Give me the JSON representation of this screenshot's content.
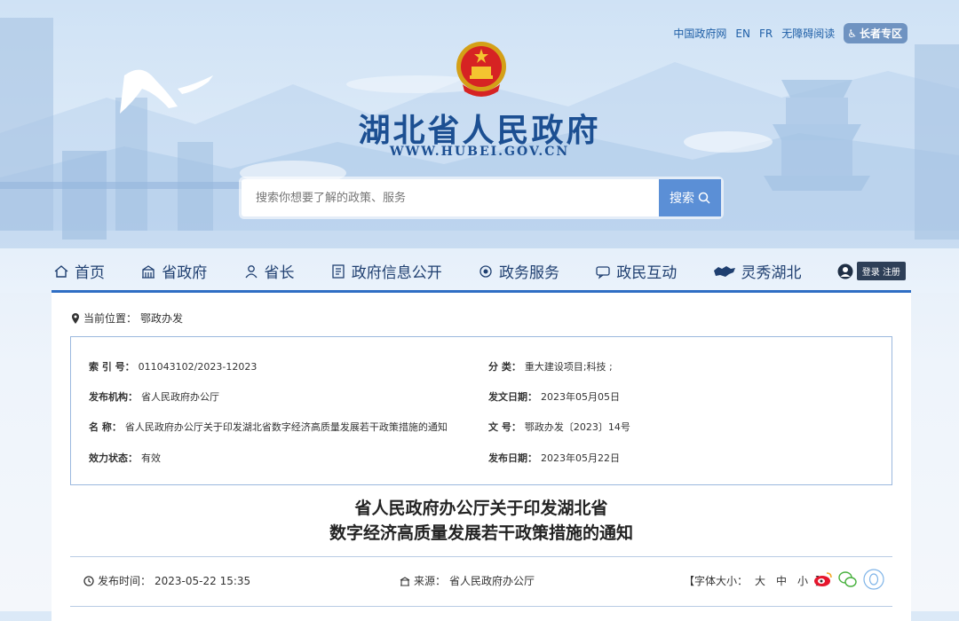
{
  "top_links": [
    "中国政府网",
    "EN",
    "FR",
    "无障碍阅读"
  ],
  "elder_label": "长者专区",
  "site": {
    "title": "湖北省人民政府",
    "url": "WWW.HUBEI.GOV.CN"
  },
  "search": {
    "placeholder": "搜索你想要了解的政策、服务",
    "button": "搜索"
  },
  "nav": [
    {
      "label": "首页",
      "icon": "home-icon"
    },
    {
      "label": "省政府",
      "icon": "building-icon"
    },
    {
      "label": "省长",
      "icon": "person-icon"
    },
    {
      "label": "政府信息公开",
      "icon": "document-icon"
    },
    {
      "label": "政务服务",
      "icon": "service-icon"
    },
    {
      "label": "政民互动",
      "icon": "chat-icon"
    },
    {
      "label": "灵秀湖北",
      "icon": "hubei-map-icon"
    }
  ],
  "login": {
    "login": "登录",
    "register": "注册"
  },
  "location": {
    "label": "当前位置：",
    "value": "鄂政办发"
  },
  "info": {
    "index_label": "索 引 号：",
    "index_value": "011043102/2023-12023",
    "category_label": "分 类：",
    "category_value": "重大建设项目;科技 ;",
    "publisher_label": "发布机构：",
    "publisher_value": "省人民政府办公厅",
    "issue_date_label": "发文日期：",
    "issue_date_value": "2023年05月05日",
    "name_label": "名 称：",
    "name_value": "省人民政府办公厅关于印发湖北省数字经济高质量发展若干政策措施的通知",
    "doc_no_label": "文 号：",
    "doc_no_value": "鄂政办发〔2023〕14号",
    "status_label": "效力状态：",
    "status_value": "有效",
    "publish_date_label": "发布日期：",
    "publish_date_value": "2023年05月22日"
  },
  "article": {
    "title_line1": "省人民政府办公厅关于印发湖北省",
    "title_line2": "数字经济高质量发展若干政策措施的通知",
    "time_label": "发布时间：",
    "time_value": "2023-05-22 15:35",
    "source_label": "来源：",
    "source_value": "省人民政府办公厅",
    "font_label": "【字体大小：",
    "font_large": "大",
    "font_medium": "中",
    "font_small": "小",
    "font_end": "】"
  },
  "colors": {
    "accent": "#2f6ec4",
    "title": "#1c4f92",
    "search_btn": "#5b8fd6"
  }
}
